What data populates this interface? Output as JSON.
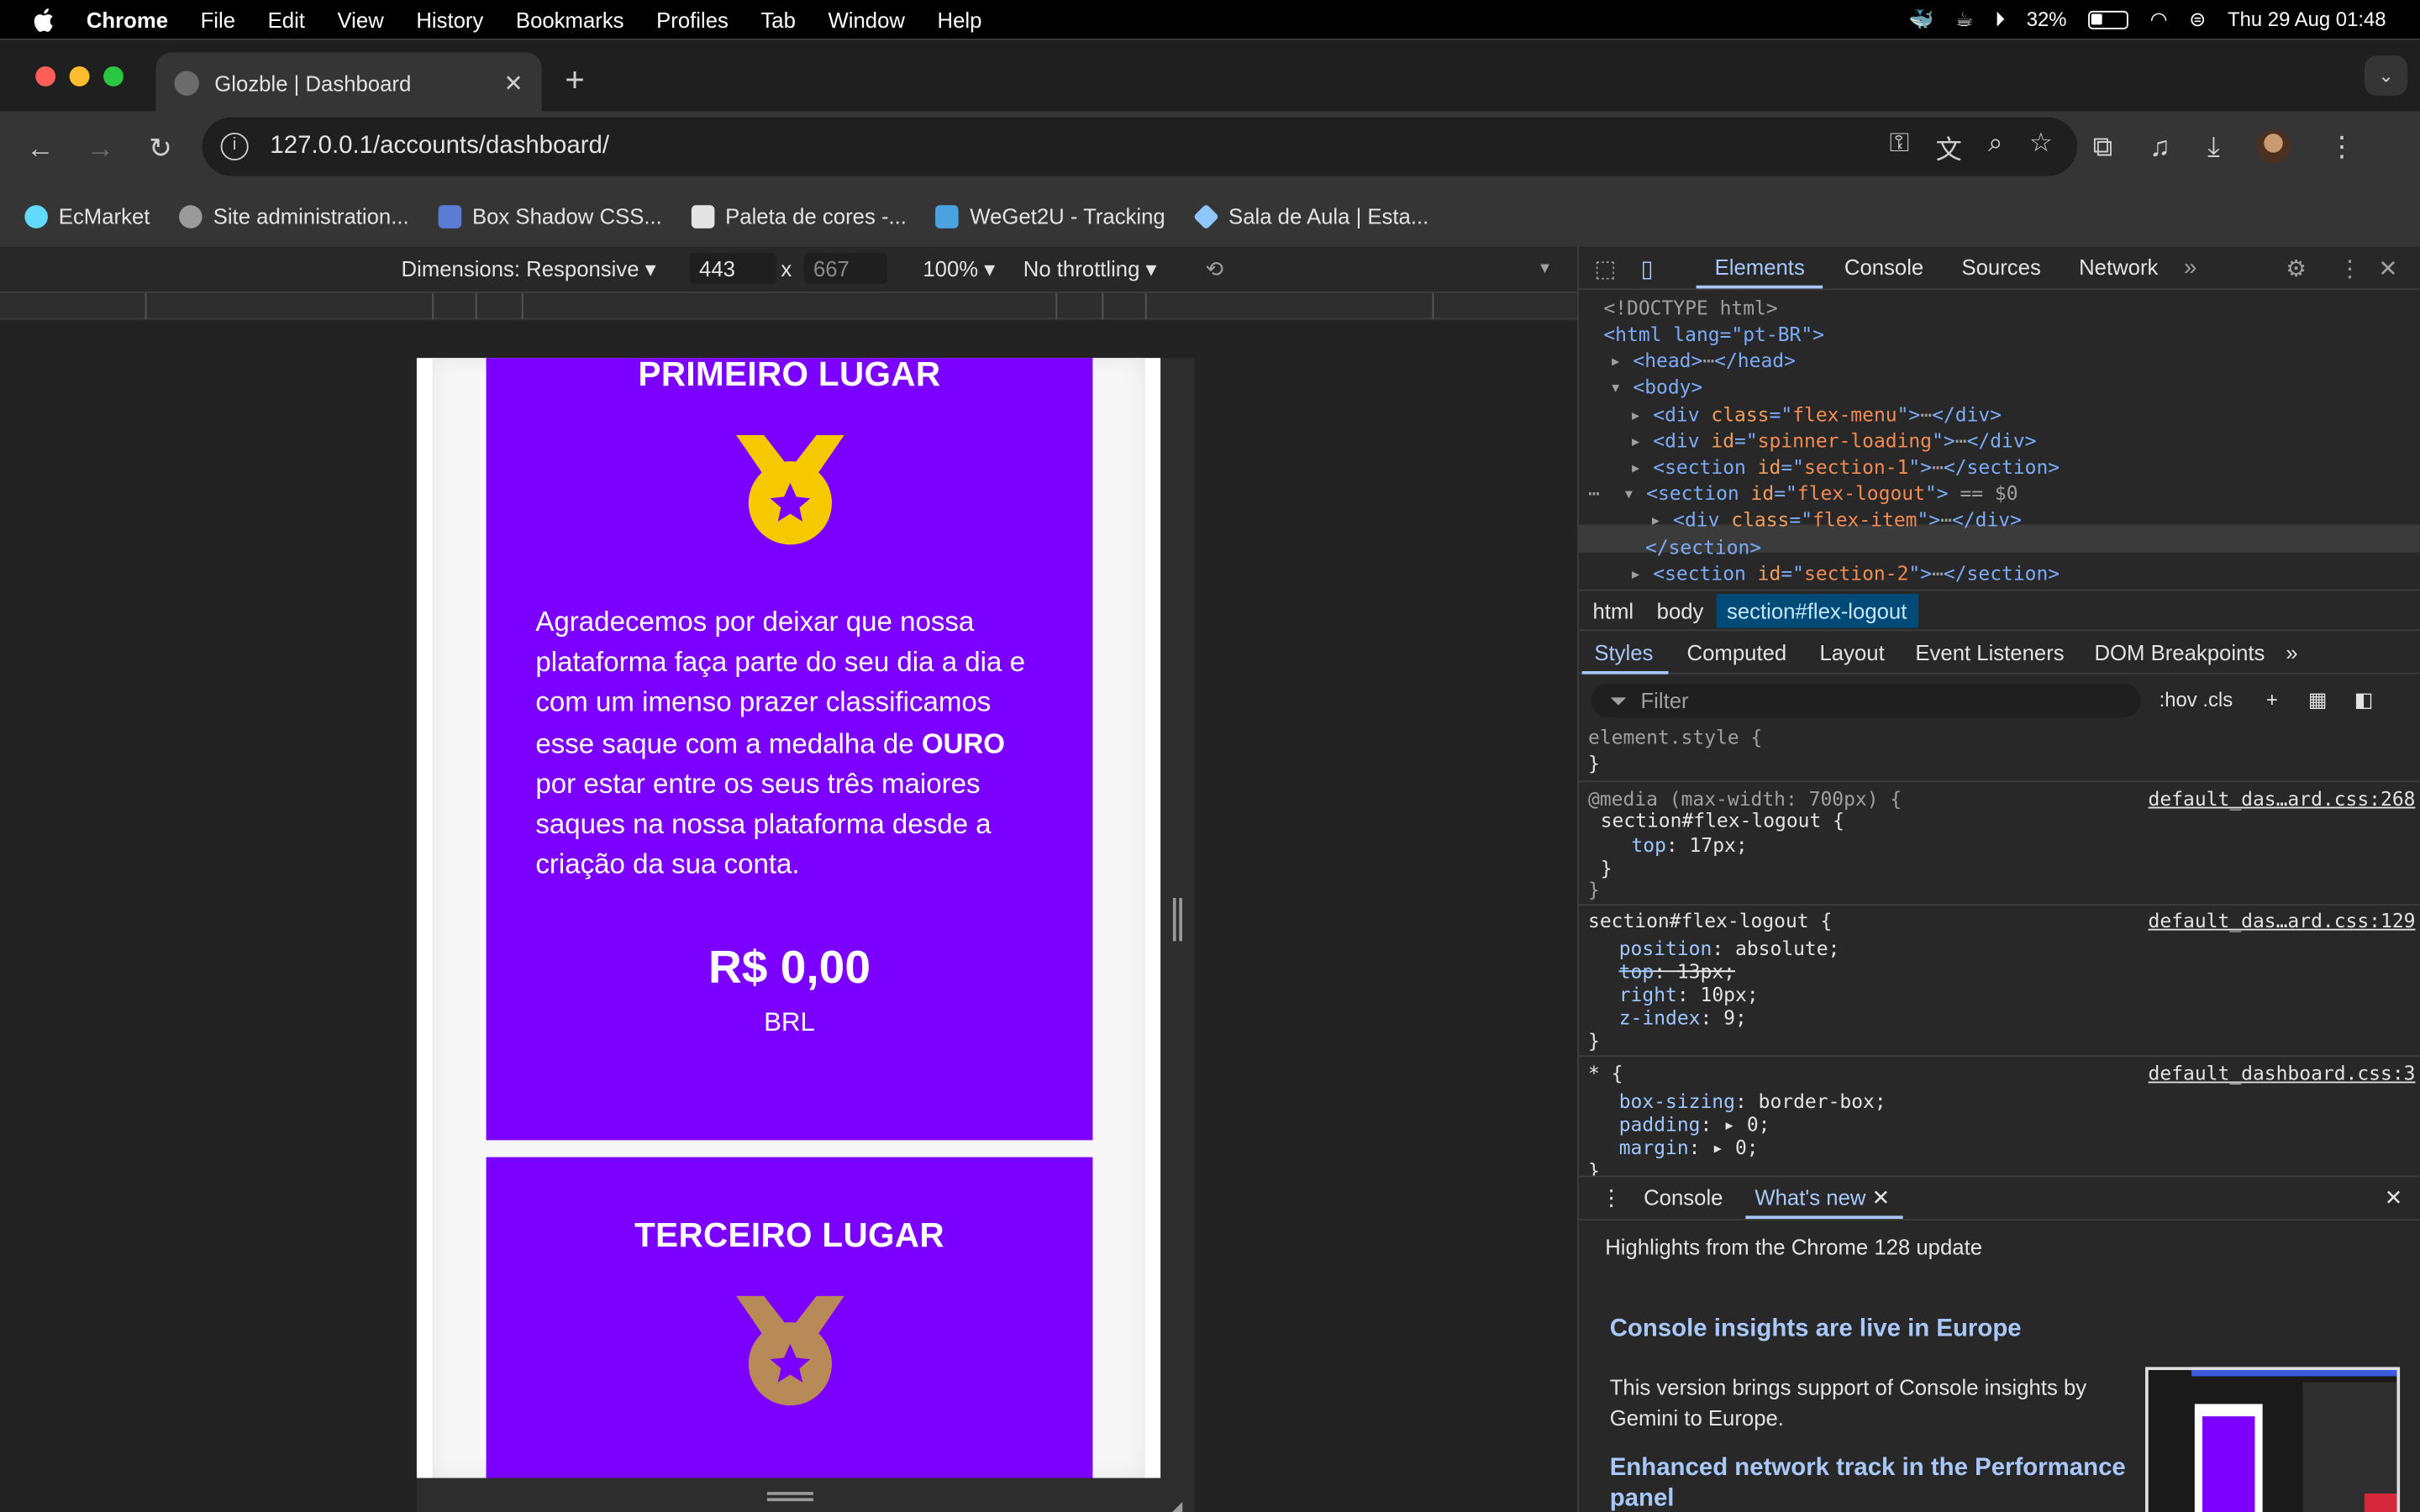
{
  "menubar": {
    "items": [
      "Chrome",
      "File",
      "Edit",
      "View",
      "History",
      "Bookmarks",
      "Profiles",
      "Tab",
      "Window",
      "Help"
    ],
    "battery": "32%",
    "datetime": "Thu 29 Aug  01:48"
  },
  "browser": {
    "tab_title": "Glozble | Dashboard",
    "url": "127.0.0.1/accounts/dashboard/",
    "bookmarks": [
      "EcMarket",
      "Site administration...",
      "Box Shadow CSS...",
      "Paleta de cores -...",
      "WeGet2U - Tracking",
      "Sala de Aula | Esta..."
    ]
  },
  "device_toolbar": {
    "dimensions": "Dimensions: Responsive",
    "width": "443",
    "times": "x",
    "height": "667",
    "zoom": "100%",
    "throttling": "No throttling"
  },
  "page": {
    "card1": {
      "title": "PRIMEIRO LUGAR",
      "text_before": "Agradecemos por deixar que nossa plataforma faça parte do seu dia a dia e com um imenso prazer classificamos esse saque com a medalha de ",
      "text_bold": "OURO",
      "text_after": " por estar entre os seus três maiores saques na nossa plataforma desde a criação da sua conta.",
      "amount": "R$ 0,00",
      "currency": "BRL",
      "medal_color": "#f5c800"
    },
    "card2": {
      "title": "TERCEIRO LUGAR",
      "medal_color": "#b88a58"
    },
    "card_color": "#7c00ff"
  },
  "devtools": {
    "tabs": [
      "Elements",
      "Console",
      "Sources",
      "Network"
    ],
    "dom": {
      "doctype": "<!DOCTYPE html>",
      "html_open": "<html lang=\"pt-BR\">",
      "head": "<head>",
      "head_close": "</head>",
      "body": "<body>",
      "div_flex_menu": "flex-menu",
      "div_spinner": "spinner-loading",
      "section1": "section-1",
      "flex_logout": "flex-logout",
      "eq_sel": "== $0",
      "flex_item": "flex-item",
      "section_close": "</section>",
      "section2": "section-2"
    },
    "breadcrumbs": [
      "html",
      "body",
      "section#flex-logout"
    ],
    "style_tabs": [
      "Styles",
      "Computed",
      "Layout",
      "Event Listeners",
      "DOM Breakpoints"
    ],
    "filter_placeholder": "Filter",
    "filter_tools": ":hov  .cls",
    "rules": {
      "element_style": "element.style {",
      "close": "}",
      "media": "@media (max-width: 700px) {",
      "media_selector": "section#flex-logout {",
      "media_prop": "top",
      "media_val": "17px;",
      "media_src": "default_das…ard.css:268",
      "rule2_selector": "section#flex-logout {",
      "rule2_src": "default_das…ard.css:129",
      "rule2_props": [
        {
          "prop": "position",
          "val": "absolute;"
        },
        {
          "prop": "top",
          "val": "13px;"
        },
        {
          "prop": "right",
          "val": "10px;"
        },
        {
          "prop": "z-index",
          "val": "9;"
        }
      ],
      "rule3_selector": "* {",
      "rule3_src": "default_dashboard.css:3",
      "rule3_props": [
        {
          "prop": "box-sizing",
          "val": "border-box;"
        },
        {
          "prop": "padding",
          "val": "▸ 0;"
        },
        {
          "prop": "margin",
          "val": "▸ 0;"
        }
      ]
    },
    "drawer": {
      "tabs": [
        "Console",
        "What's new"
      ],
      "highlights": "Highlights from the Chrome 128 update",
      "h1": "Console insights are live in Europe",
      "p1": "This version brings support of Console insights by Gemini to Europe.",
      "h2": "Enhanced network track in the Performance panel"
    }
  }
}
